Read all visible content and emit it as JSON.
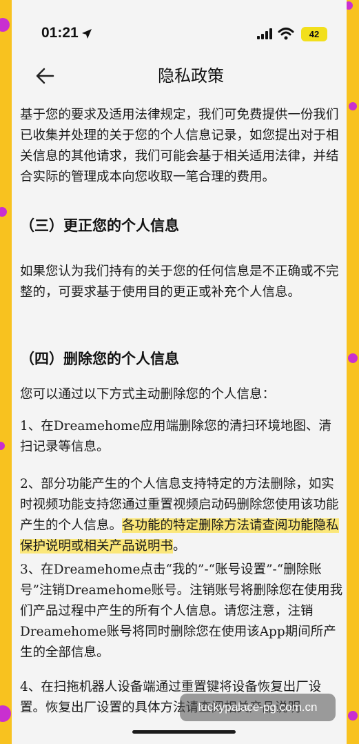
{
  "status_bar": {
    "time": "01:21",
    "battery": "42",
    "icons": [
      "location-arrow-icon",
      "signal-icon",
      "wifi-icon",
      "battery-icon"
    ]
  },
  "nav": {
    "title": "隐私政策",
    "back_icon": "back-arrow-icon"
  },
  "content": {
    "p1": "基于您的要求及适用法律规定，我们可免费提供一份我们已收集并处理的关于您的个人信息记录，如您提出对于相关信息的其他请求，我们可能会基于相关适用法律，并结合实际的管理成本向您收取一笔合理的费用。",
    "h3_correct": "（三）更正您的个人信息",
    "p2": "如果您认为我们持有的关于您的任何信息是不正确或不完整的，可要求基于使用目的更正或补充个人信息。",
    "h3_delete": "（四）删除您的个人信息",
    "p3": "您可以通过以下方式主动删除您的个人信息：",
    "p4": "1、在Dreamehome应用端删除您的清扫环境地图、清扫记录等信息。",
    "p5_a": "2、部分功能产生的个人信息支持特定的方法删除，如实时视频功能支持您通过重置视频启动码删除您使用该功能产生的个人信息。",
    "p5_b": "各功能的特定删除方法请查阅功能隐私保护说明或相关产品说明书",
    "p5_c": "。",
    "p6": "3、在Dreamehome点击“我的”-“账号设置”-“删除账号”注销Dreamehome账号。注销账号将删除您在使用我们产品过程中产生的所有个人信息。请您注意，注销Dreamehome账号将同时删除您在使用该App期间所产生的全部信息。",
    "p7": "4、在扫拖机器人设备端通过重置键将设备恢复出厂设置。恢复出厂设置的具体方法请查阅相关产品说明"
  },
  "watermark": "luckypalace-pg.com.cn",
  "colors": {
    "frame_yellow": "#f8c21f",
    "dot_magenta": "#c92fd0",
    "highlight": "#fbe77a",
    "battery_yellow": "#f2df1c",
    "page_bg": "#f4f4f4"
  }
}
